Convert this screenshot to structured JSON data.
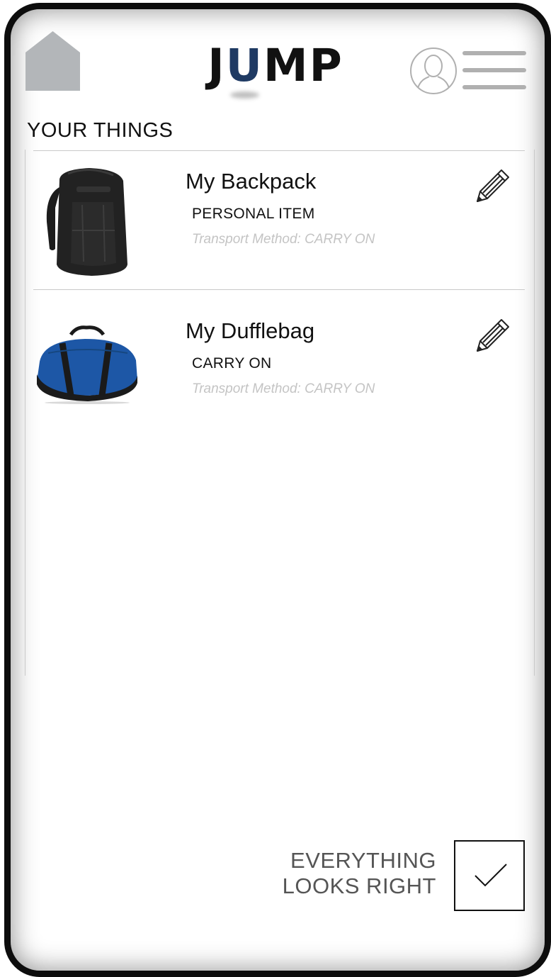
{
  "header": {
    "logo": {
      "part1": "J",
      "part2": "U",
      "part3": "MP"
    }
  },
  "section_title": "YOUR THINGS",
  "items": [
    {
      "name": "My Backpack",
      "category": "PERSONAL ITEM",
      "transport": "Transport Method: CARRY ON",
      "image_icon": "backpack-image"
    },
    {
      "name": "My Dufflebag",
      "category": "CARRY ON",
      "transport": "Transport Method: CARRY ON",
      "image_icon": "dufflebag-image"
    }
  ],
  "confirm": {
    "line1": "EVERYTHING",
    "line2": "LOOKS RIGHT"
  },
  "colors": {
    "logo_accent": "#1f3a63",
    "home_icon": "#b3b6b9",
    "duffle_blue": "#1d57a6"
  }
}
